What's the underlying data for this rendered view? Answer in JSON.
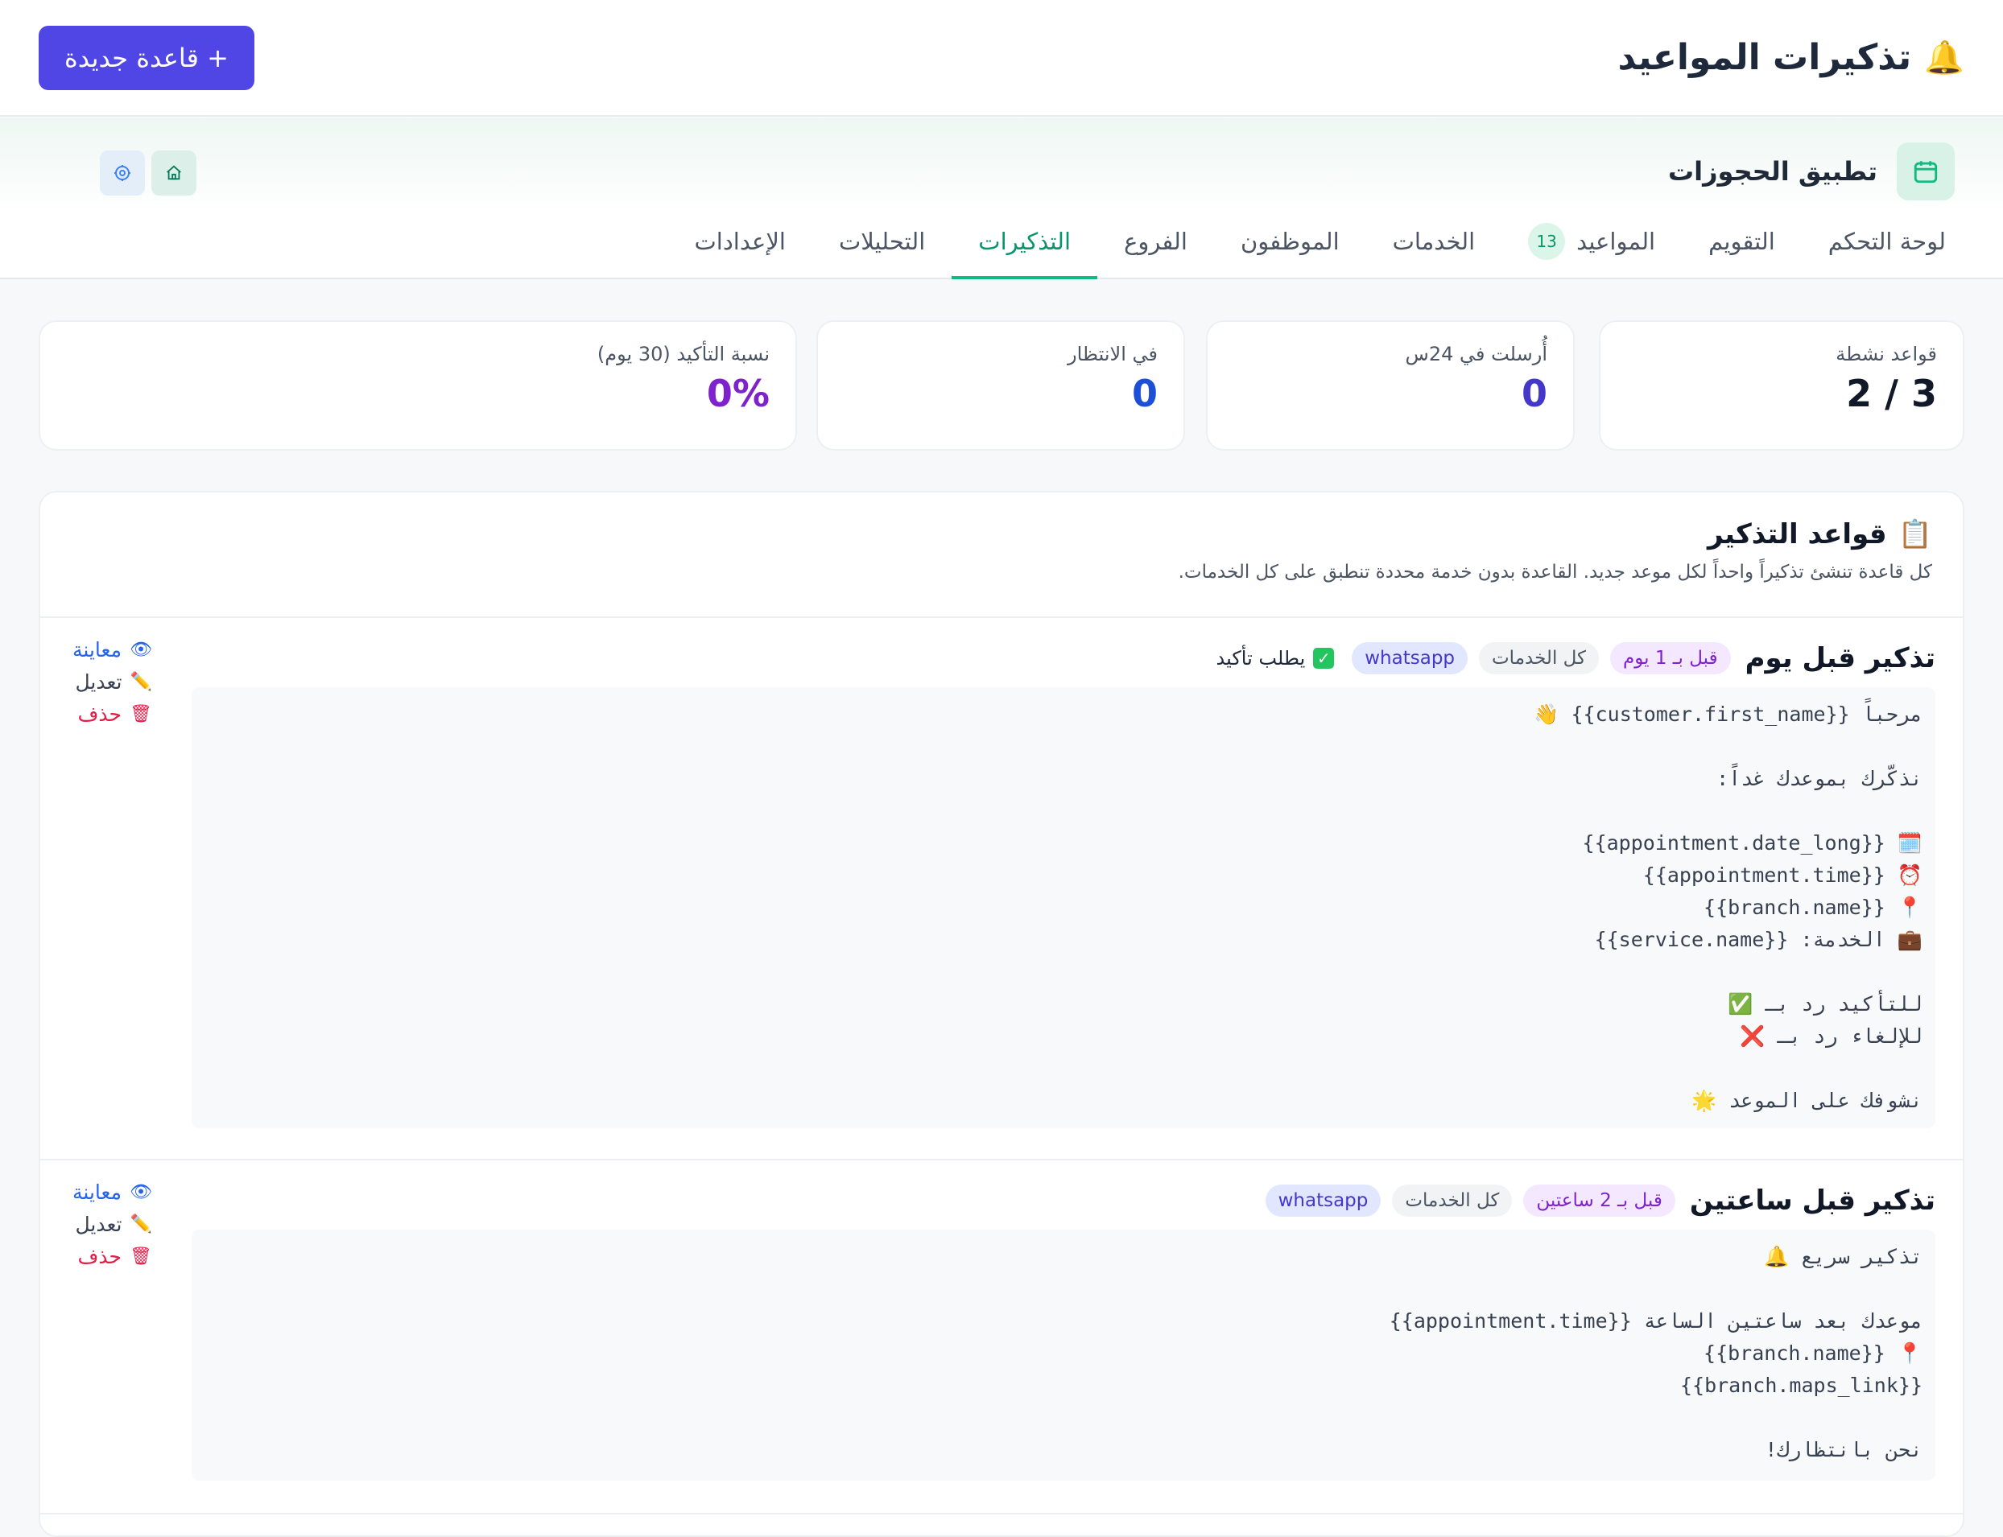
{
  "header": {
    "title": "تذكيرات المواعيد",
    "title_icon": "bell-icon",
    "new_button": "+ قاعدة جديدة"
  },
  "app": {
    "name": "تطبيق الحجوزات",
    "icon": "calendar-icon"
  },
  "tabs": [
    {
      "label": "لوحة التحكم"
    },
    {
      "label": "التقويم"
    },
    {
      "label": "المواعيد",
      "count": "13"
    },
    {
      "label": "الخدمات"
    },
    {
      "label": "الموظفون"
    },
    {
      "label": "الفروع"
    },
    {
      "label": "التذكيرات",
      "active": true
    },
    {
      "label": "التحليلات"
    },
    {
      "label": "الإعدادات"
    }
  ],
  "stats": [
    {
      "label": "قواعد نشطة",
      "value": "2 / 3",
      "color": "#111827"
    },
    {
      "label": "أُرسلت في 24س",
      "value": "0",
      "color": "#4338ca"
    },
    {
      "label": "في الانتظار",
      "value": "0",
      "color": "#1d4ed8"
    },
    {
      "label": "نسبة التأكيد (30 يوم)",
      "value": "0%",
      "color": "#7e22ce"
    }
  ],
  "rules_panel": {
    "title": "قواعد التذكير",
    "title_icon": "clipboard-icon",
    "subtitle": "كل قاعدة تنشئ تذكيراً واحداً لكل موعد جديد. القاعدة بدون خدمة محددة تنطبق على كل الخدمات."
  },
  "rules": [
    {
      "name": "تذكير قبل يوم",
      "timing": "قبل بـ 1 يوم",
      "services": "كل الخدمات",
      "channel": "whatsapp",
      "confirm": "يطلب تأكيد",
      "message": "مرحباً {{customer.first_name}} 👋\n\nنذكّرك بموعدك غداً:\n\n🗓️ {{appointment.date_long}}\n⏰ {{appointment.time}}\n📍 {{branch.name}}\n💼 الخدمة: {{service.name}}\n\nللتأكيد رد بـ ✅\nللإلغاء رد بـ ❌\n\nنشوفك على الموعد 🌟"
    },
    {
      "name": "تذكير قبل ساعتين",
      "timing": "قبل بـ 2 ساعتين",
      "services": "كل الخدمات",
      "channel": "whatsapp",
      "message": "تذكير سريع 🔔\n\nموعدك بعد ساعتين الساعة {{appointment.time}}\n📍 {{branch.name}}\n{{branch.maps_link}}\n\nنحن بانتظارك!"
    }
  ],
  "actions": {
    "preview": "معاينة",
    "edit": "تعديل",
    "delete": "حذف",
    "preview_icon": "eye-icon",
    "edit_icon": "pencil-icon",
    "delete_icon": "trash-icon"
  }
}
